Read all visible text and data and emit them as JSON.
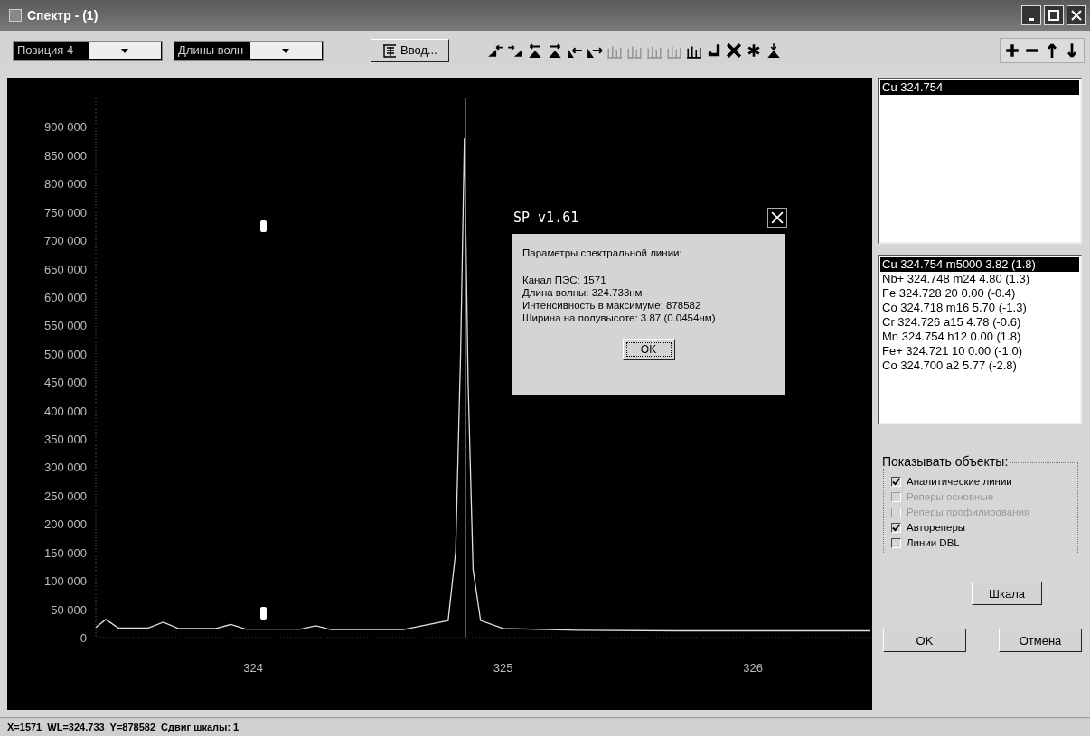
{
  "window": {
    "title": "Спектр - (1)"
  },
  "toolbar": {
    "position_select": {
      "value": "Позиция 4"
    },
    "mode_select": {
      "value": "Длины волн"
    },
    "input_button": {
      "label": "Ввод..."
    },
    "tools": [
      {
        "kind": "step-left",
        "disabled": false
      },
      {
        "kind": "step-right",
        "disabled": false
      },
      {
        "kind": "peak-left",
        "disabled": false
      },
      {
        "kind": "peak-right",
        "disabled": false
      },
      {
        "kind": "shift-left",
        "disabled": false
      },
      {
        "kind": "shift-right",
        "disabled": false
      },
      {
        "kind": "bars",
        "disabled": true
      },
      {
        "kind": "bars",
        "disabled": true
      },
      {
        "kind": "bars",
        "disabled": true
      },
      {
        "kind": "bars",
        "disabled": true
      },
      {
        "kind": "bars",
        "disabled": false
      },
      {
        "kind": "enter",
        "disabled": false
      },
      {
        "kind": "delete",
        "disabled": false
      },
      {
        "kind": "star",
        "disabled": false
      },
      {
        "kind": "peak-mark",
        "disabled": false
      }
    ],
    "scale_tools": [
      {
        "kind": "plus"
      },
      {
        "kind": "minus"
      },
      {
        "kind": "up"
      },
      {
        "kind": "down"
      }
    ]
  },
  "chart": {
    "chart_data": {
      "type": "line",
      "x": [
        323.37,
        323.41,
        323.46,
        323.58,
        323.64,
        323.7,
        323.85,
        323.91,
        323.97,
        324.19,
        324.25,
        324.31,
        324.6,
        324.78,
        324.81,
        324.83,
        324.845,
        324.86,
        324.88,
        324.91,
        325.0,
        325.3,
        325.7,
        326.1,
        326.47
      ],
      "xlim": [
        323.37,
        326.47
      ],
      "ylim": [
        0,
        950000
      ],
      "ref_lines": [
        {
          "axis": "x",
          "value": 324.85
        }
      ],
      "series": [
        {
          "color": "#e0e0e0",
          "values": [
            18000,
            32000,
            17000,
            17000,
            27000,
            16000,
            16000,
            23000,
            15000,
            15000,
            21000,
            14000,
            14000,
            30000,
            150000,
            500000,
            880000,
            450000,
            120000,
            30000,
            16000,
            13000,
            12000,
            12000,
            12000
          ]
        }
      ],
      "xticks": [
        324,
        325,
        326
      ],
      "yticks": [
        {
          "value": 0,
          "label": "0"
        },
        {
          "value": 50000,
          "label": "50 000"
        },
        {
          "value": 100000,
          "label": "100 000"
        },
        {
          "value": 150000,
          "label": "150 000"
        },
        {
          "value": 200000,
          "label": "200 000"
        },
        {
          "value": 250000,
          "label": "250 000"
        },
        {
          "value": 300000,
          "label": "300 000"
        },
        {
          "value": 350000,
          "label": "350 000"
        },
        {
          "value": 400000,
          "label": "400 000"
        },
        {
          "value": 450000,
          "label": "450 000"
        },
        {
          "value": 500000,
          "label": "500 000"
        },
        {
          "value": 550000,
          "label": "550 000"
        },
        {
          "value": 600000,
          "label": "600 000"
        },
        {
          "value": 650000,
          "label": "650 000"
        },
        {
          "value": 700000,
          "label": "700 000"
        },
        {
          "value": 750000,
          "label": "750 000"
        },
        {
          "value": 800000,
          "label": "800 000"
        },
        {
          "value": 850000,
          "label": "850 000"
        },
        {
          "value": 900000,
          "label": "900 000"
        }
      ]
    },
    "dialog": {
      "title": "SP v1.61",
      "heading": "Параметры спектральной линии:",
      "lines": [
        "Канал ПЭС: 1571",
        "Длина волны: 324.733нм",
        "Интенсивность в максимуме: 878582",
        "Ширина на полувысоте: 3.87 (0.0454нм)"
      ],
      "button": "OK"
    }
  },
  "side_panel": {
    "lines_list": [
      {
        "label": "Cu 324.754",
        "selected": true
      }
    ],
    "candidates_list": [
      {
        "label": "Cu  324.754 m5000 3.82 (1.8)",
        "selected": true
      },
      {
        "label": "Nb+  324.748 m24 4.80 (1.3)",
        "selected": false
      },
      {
        "label": "Fe  324.728  20 0.00 (-0.4)",
        "selected": false
      },
      {
        "label": "Co  324.718 m16 5.70 (-1.3)",
        "selected": false
      },
      {
        "label": "Cr  324.726 a15 4.78 (-0.6)",
        "selected": false
      },
      {
        "label": "Mn  324.754 h12 0.00 (1.8)",
        "selected": false
      },
      {
        "label": "Fe+  324.721  10 0.00 (-1.0)",
        "selected": false
      },
      {
        "label": "Co  324.700 a2 5.77 (-2.8)",
        "selected": false
      }
    ],
    "objects_group": {
      "title": "Показывать объекты:",
      "options": [
        {
          "label": "Аналитические линии",
          "checked": true,
          "disabled": false
        },
        {
          "label": "Реперы основные",
          "checked": false,
          "disabled": true
        },
        {
          "label": "Реперы профилирования",
          "checked": false,
          "disabled": true
        },
        {
          "label": "Автореперы",
          "checked": true,
          "disabled": false
        },
        {
          "label": "Линии DBL",
          "checked": false,
          "disabled": false
        }
      ]
    },
    "scale_button": "Шкала",
    "ok_button": "OK",
    "cancel_button": "Отмена"
  },
  "status_bar": {
    "text": "X=1571  WL=324.733  Y=878582  Сдвиг шкалы: 1"
  }
}
